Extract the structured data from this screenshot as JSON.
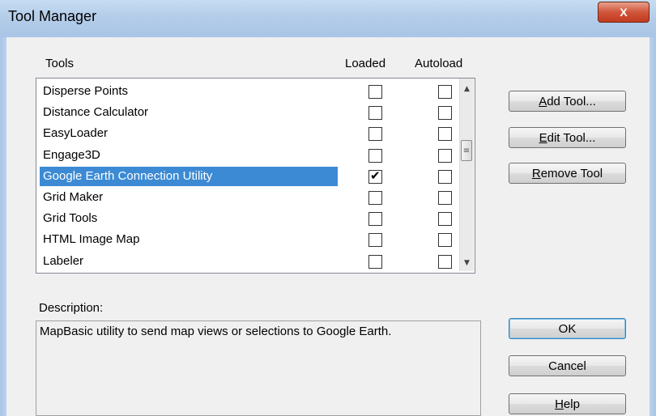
{
  "window": {
    "title": "Tool Manager",
    "close_label": "X"
  },
  "headers": {
    "tools": "Tools",
    "loaded": "Loaded",
    "autoload": "Autoload"
  },
  "tools": [
    {
      "name": "Disperse Points",
      "loaded": false,
      "autoload": false
    },
    {
      "name": "Distance Calculator",
      "loaded": false,
      "autoload": false
    },
    {
      "name": "EasyLoader",
      "loaded": false,
      "autoload": false
    },
    {
      "name": "Engage3D",
      "loaded": false,
      "autoload": false
    },
    {
      "name": "Google Earth Connection Utility",
      "loaded": true,
      "autoload": false,
      "selected": true
    },
    {
      "name": "Grid Maker",
      "loaded": false,
      "autoload": false
    },
    {
      "name": "Grid Tools",
      "loaded": false,
      "autoload": false
    },
    {
      "name": "HTML Image Map",
      "loaded": false,
      "autoload": false
    },
    {
      "name": "Labeler",
      "loaded": false,
      "autoload": false
    }
  ],
  "buttons": {
    "add_tool": {
      "key": "A",
      "rest": "dd Tool..."
    },
    "edit_tool": {
      "key": "E",
      "rest": "dit Tool..."
    },
    "remove_tool": {
      "key": "R",
      "rest": "emove Tool"
    },
    "ok": "OK",
    "cancel": "Cancel",
    "help": {
      "key": "H",
      "rest": "elp"
    }
  },
  "description": {
    "label": "Description:",
    "text": "MapBasic utility to send map views or selections to Google Earth."
  },
  "scrollbar": {
    "up_icon": "▲",
    "down_icon": "▼",
    "grip_icon": "≡"
  },
  "check_glyph": "✔"
}
